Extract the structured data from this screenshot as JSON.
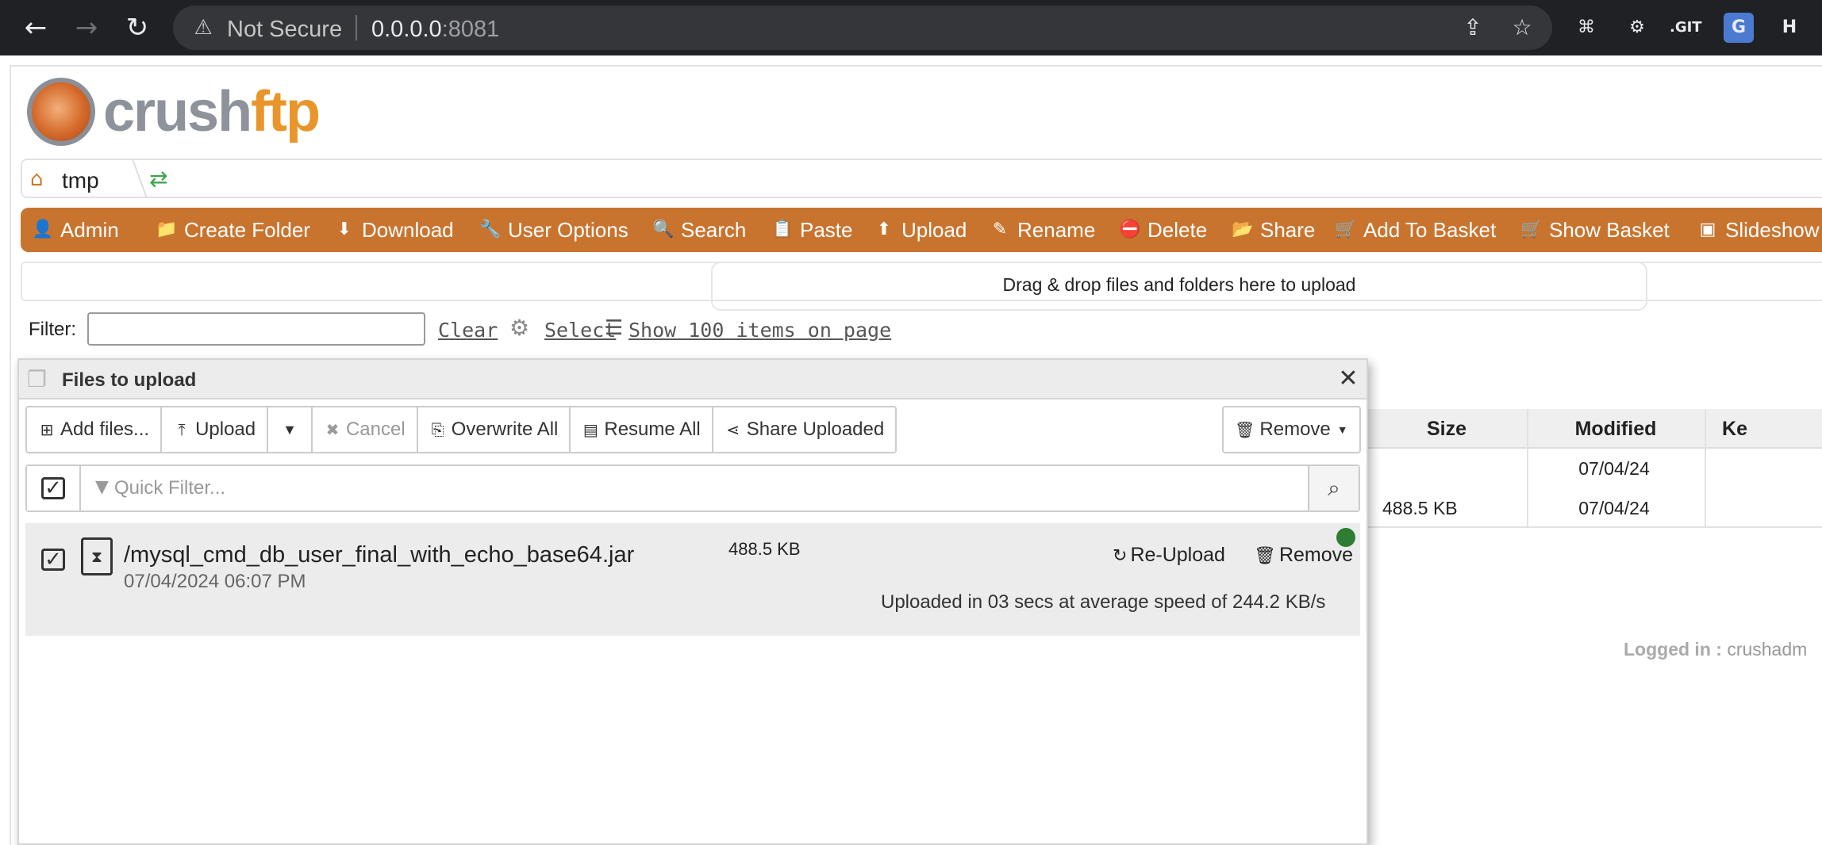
{
  "browser": {
    "security_label": "Not Secure",
    "url_host": "0.0.0.0",
    "url_port": ":8081",
    "extensions": [
      "⌘",
      "⚙",
      ".GIT",
      "G",
      "H"
    ]
  },
  "app": {
    "logo_text_a": "crush",
    "logo_text_b": "ftp"
  },
  "breadcrumb": {
    "current": "tmp"
  },
  "toolbar": {
    "items": [
      {
        "label": "Admin",
        "icon": "👤"
      },
      {
        "label": "Create Folder",
        "icon": "📁"
      },
      {
        "label": "Download",
        "icon": "⬇"
      },
      {
        "label": "User Options",
        "icon": "🔧"
      },
      {
        "label": "Search",
        "icon": "🔍"
      },
      {
        "label": "Paste",
        "icon": "📋"
      },
      {
        "label": "Upload",
        "icon": "⬆"
      },
      {
        "label": "Rename",
        "icon": "✎"
      },
      {
        "label": "Delete",
        "icon": "⛔"
      },
      {
        "label": "Share",
        "icon": "📂"
      },
      {
        "label": "Add To Basket",
        "icon": "🛒"
      },
      {
        "label": "Show Basket",
        "icon": "🛒"
      },
      {
        "label": "Slideshow",
        "icon": "▣"
      }
    ]
  },
  "dropzone": {
    "text": "Drag & drop files and folders here to upload"
  },
  "filter": {
    "label": "Filter:",
    "value": "",
    "clear": "Clear",
    "select": "Select",
    "show_items": "Show 100 items on page"
  },
  "file_table": {
    "headers": [
      "Size",
      "Modified",
      "Ke"
    ],
    "rows": [
      {
        "size": "",
        "modified": "07/04/24"
      },
      {
        "size": "488.5 KB",
        "modified": "07/04/24"
      }
    ],
    "logged_in_label": "Logged in :",
    "logged_in_user": "crushadm"
  },
  "upload_dialog": {
    "title": "Files to upload",
    "buttons": {
      "add_files": "Add files...",
      "upload": "Upload",
      "cancel": "Cancel",
      "overwrite_all": "Overwrite All",
      "resume_all": "Resume All",
      "share_uploaded": "Share Uploaded",
      "remove": "Remove"
    },
    "quick_filter_placeholder": "Quick Filter...",
    "file": {
      "name": "/mysql_cmd_db_user_final_with_echo_base64.jar",
      "date": "07/04/2024 06:07 PM",
      "size": "488.5 KB",
      "reupload": "Re-Upload",
      "remove": "Remove",
      "status": "Uploaded in 03 secs at average speed of 244.2 KB/s",
      "status_color": "#2e7d32"
    }
  }
}
